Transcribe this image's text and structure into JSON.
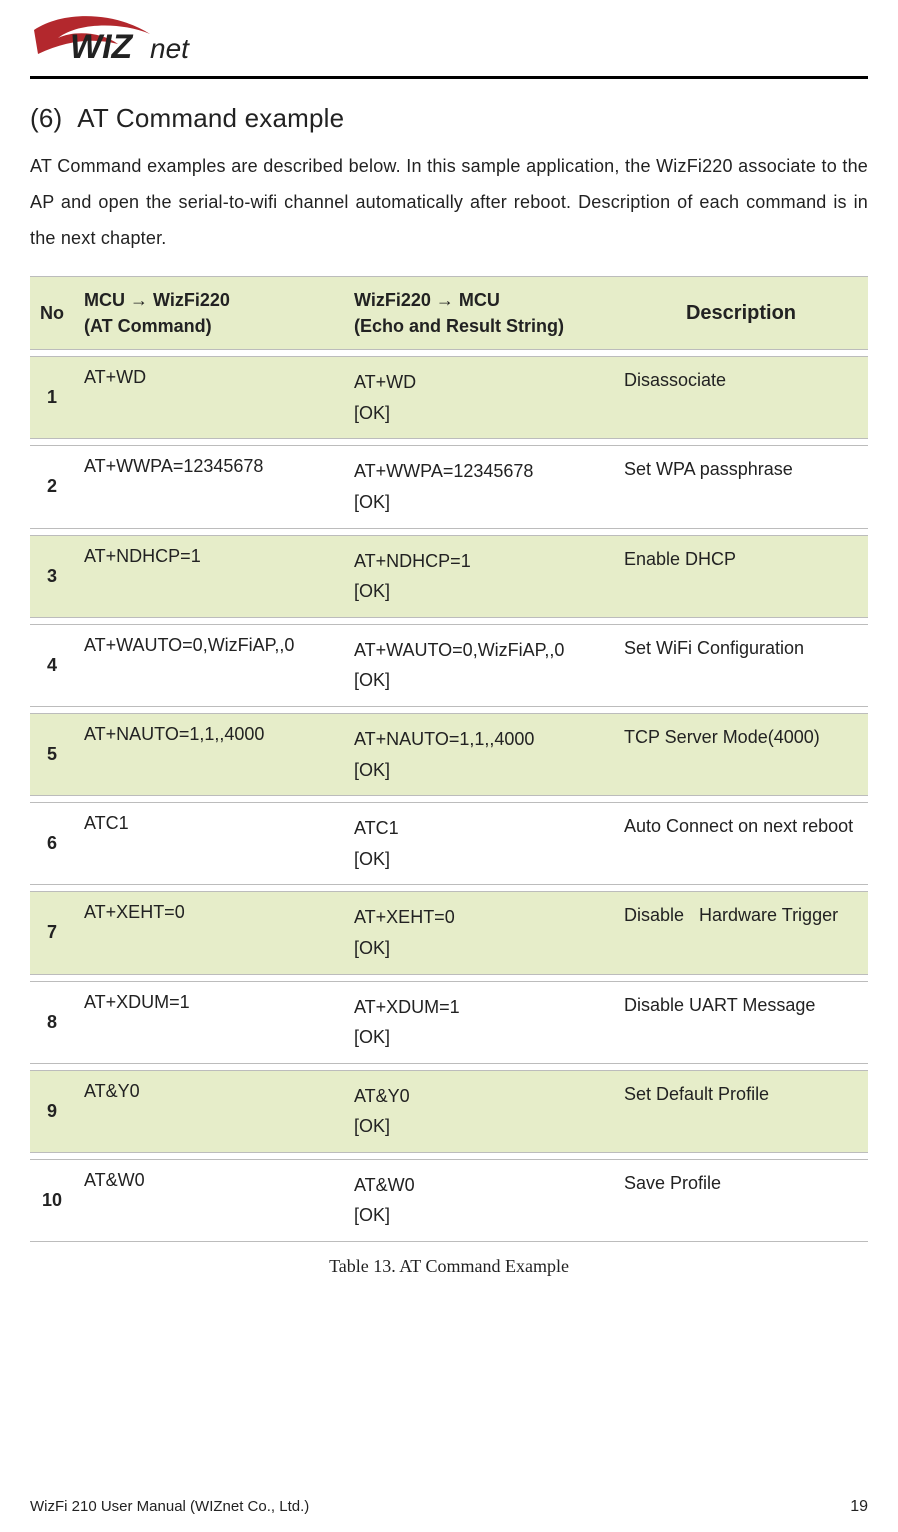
{
  "logo": {
    "brand_word": "WIZ",
    "brand_suffix": "net"
  },
  "section_heading": "(6)  AT Command example",
  "intro_text": "AT Command examples are described below. In this sample application, the WizFi220 associate to the AP and open the serial-to-wifi channel automatically after reboot. Description of each command is in the next chapter.",
  "table": {
    "headers": {
      "no": "No",
      "mcu": "MCU → WizFi220\n(AT Command)",
      "echo": "WizFi220 → MCU\n(Echo and Result String)",
      "desc": "Description"
    },
    "rows": [
      {
        "no": "1",
        "mcu": "AT+WD",
        "echo": "AT+WD\n[OK]",
        "desc": "Disassociate"
      },
      {
        "no": "2",
        "mcu": "AT+WWPA=12345678",
        "echo": "AT+WWPA=12345678\n[OK]",
        "desc": "Set WPA passphrase"
      },
      {
        "no": "3",
        "mcu": "AT+NDHCP=1",
        "echo": "AT+NDHCP=1\n[OK]",
        "desc": "Enable DHCP"
      },
      {
        "no": "4",
        "mcu": "AT+WAUTO=0,WizFiAP,,0",
        "echo": "AT+WAUTO=0,WizFiAP,,0\n[OK]",
        "desc": "Set WiFi Configuration"
      },
      {
        "no": "5",
        "mcu": "AT+NAUTO=1,1,,4000",
        "echo": "AT+NAUTO=1,1,,4000\n[OK]",
        "desc": "TCP Server Mode(4000)"
      },
      {
        "no": "6",
        "mcu": "ATC1",
        "echo": "ATC1\n[OK]",
        "desc": "Auto Connect on next reboot"
      },
      {
        "no": "7",
        "mcu": "AT+XEHT=0",
        "echo": "AT+XEHT=0\n[OK]",
        "desc": "Disable   Hardware Trigger"
      },
      {
        "no": "8",
        "mcu": "AT+XDUM=1",
        "echo": "AT+XDUM=1\n[OK]",
        "desc": "Disable UART Message"
      },
      {
        "no": "9",
        "mcu": "AT&Y0",
        "echo": "AT&Y0\n[OK]",
        "desc": "Set Default Profile"
      },
      {
        "no": "10",
        "mcu": "AT&W0",
        "echo": "AT&W0\n[OK]",
        "desc": "Save Profile"
      }
    ]
  },
  "caption": "Table 13. AT Command Example",
  "footer_left": "WizFi 210 User Manual (WIZnet Co., Ltd.)",
  "footer_page": "19"
}
